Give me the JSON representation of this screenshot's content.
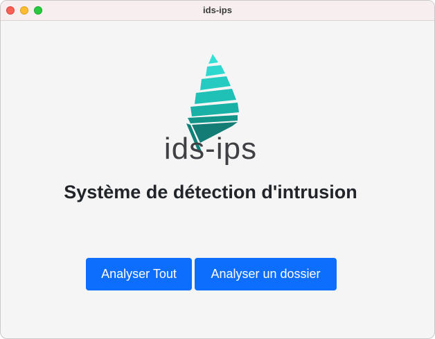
{
  "window": {
    "title": "ids-ips"
  },
  "logo": {
    "icon": "stacked-layers-logo-icon",
    "text": "ids-ips",
    "colors": [
      "#33e0d6",
      "#1fc2b6",
      "#16a39a",
      "#0f8078"
    ]
  },
  "main": {
    "heading": "Système de détection d'intrusion"
  },
  "actions": {
    "analyze_all_label": "Analyser Tout",
    "analyze_folder_label": "Analyser un dossier"
  },
  "colors": {
    "primary_button": "#0d6efd",
    "button_text": "#ffffff",
    "background": "#f5f5f5"
  }
}
